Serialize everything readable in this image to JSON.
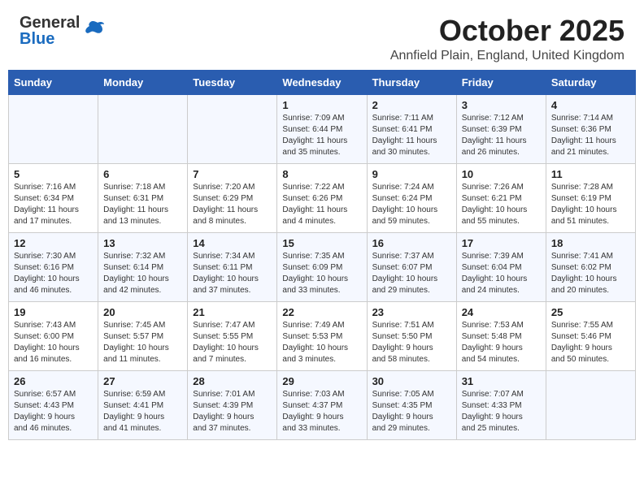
{
  "header": {
    "logo_line1": "General",
    "logo_line2": "Blue",
    "month": "October 2025",
    "location": "Annfield Plain, England, United Kingdom"
  },
  "weekdays": [
    "Sunday",
    "Monday",
    "Tuesday",
    "Wednesday",
    "Thursday",
    "Friday",
    "Saturday"
  ],
  "weeks": [
    [
      {
        "day": "",
        "detail": ""
      },
      {
        "day": "",
        "detail": ""
      },
      {
        "day": "",
        "detail": ""
      },
      {
        "day": "1",
        "detail": "Sunrise: 7:09 AM\nSunset: 6:44 PM\nDaylight: 11 hours\nand 35 minutes."
      },
      {
        "day": "2",
        "detail": "Sunrise: 7:11 AM\nSunset: 6:41 PM\nDaylight: 11 hours\nand 30 minutes."
      },
      {
        "day": "3",
        "detail": "Sunrise: 7:12 AM\nSunset: 6:39 PM\nDaylight: 11 hours\nand 26 minutes."
      },
      {
        "day": "4",
        "detail": "Sunrise: 7:14 AM\nSunset: 6:36 PM\nDaylight: 11 hours\nand 21 minutes."
      }
    ],
    [
      {
        "day": "5",
        "detail": "Sunrise: 7:16 AM\nSunset: 6:34 PM\nDaylight: 11 hours\nand 17 minutes."
      },
      {
        "day": "6",
        "detail": "Sunrise: 7:18 AM\nSunset: 6:31 PM\nDaylight: 11 hours\nand 13 minutes."
      },
      {
        "day": "7",
        "detail": "Sunrise: 7:20 AM\nSunset: 6:29 PM\nDaylight: 11 hours\nand 8 minutes."
      },
      {
        "day": "8",
        "detail": "Sunrise: 7:22 AM\nSunset: 6:26 PM\nDaylight: 11 hours\nand 4 minutes."
      },
      {
        "day": "9",
        "detail": "Sunrise: 7:24 AM\nSunset: 6:24 PM\nDaylight: 10 hours\nand 59 minutes."
      },
      {
        "day": "10",
        "detail": "Sunrise: 7:26 AM\nSunset: 6:21 PM\nDaylight: 10 hours\nand 55 minutes."
      },
      {
        "day": "11",
        "detail": "Sunrise: 7:28 AM\nSunset: 6:19 PM\nDaylight: 10 hours\nand 51 minutes."
      }
    ],
    [
      {
        "day": "12",
        "detail": "Sunrise: 7:30 AM\nSunset: 6:16 PM\nDaylight: 10 hours\nand 46 minutes."
      },
      {
        "day": "13",
        "detail": "Sunrise: 7:32 AM\nSunset: 6:14 PM\nDaylight: 10 hours\nand 42 minutes."
      },
      {
        "day": "14",
        "detail": "Sunrise: 7:34 AM\nSunset: 6:11 PM\nDaylight: 10 hours\nand 37 minutes."
      },
      {
        "day": "15",
        "detail": "Sunrise: 7:35 AM\nSunset: 6:09 PM\nDaylight: 10 hours\nand 33 minutes."
      },
      {
        "day": "16",
        "detail": "Sunrise: 7:37 AM\nSunset: 6:07 PM\nDaylight: 10 hours\nand 29 minutes."
      },
      {
        "day": "17",
        "detail": "Sunrise: 7:39 AM\nSunset: 6:04 PM\nDaylight: 10 hours\nand 24 minutes."
      },
      {
        "day": "18",
        "detail": "Sunrise: 7:41 AM\nSunset: 6:02 PM\nDaylight: 10 hours\nand 20 minutes."
      }
    ],
    [
      {
        "day": "19",
        "detail": "Sunrise: 7:43 AM\nSunset: 6:00 PM\nDaylight: 10 hours\nand 16 minutes."
      },
      {
        "day": "20",
        "detail": "Sunrise: 7:45 AM\nSunset: 5:57 PM\nDaylight: 10 hours\nand 11 minutes."
      },
      {
        "day": "21",
        "detail": "Sunrise: 7:47 AM\nSunset: 5:55 PM\nDaylight: 10 hours\nand 7 minutes."
      },
      {
        "day": "22",
        "detail": "Sunrise: 7:49 AM\nSunset: 5:53 PM\nDaylight: 10 hours\nand 3 minutes."
      },
      {
        "day": "23",
        "detail": "Sunrise: 7:51 AM\nSunset: 5:50 PM\nDaylight: 9 hours\nand 58 minutes."
      },
      {
        "day": "24",
        "detail": "Sunrise: 7:53 AM\nSunset: 5:48 PM\nDaylight: 9 hours\nand 54 minutes."
      },
      {
        "day": "25",
        "detail": "Sunrise: 7:55 AM\nSunset: 5:46 PM\nDaylight: 9 hours\nand 50 minutes."
      }
    ],
    [
      {
        "day": "26",
        "detail": "Sunrise: 6:57 AM\nSunset: 4:43 PM\nDaylight: 9 hours\nand 46 minutes."
      },
      {
        "day": "27",
        "detail": "Sunrise: 6:59 AM\nSunset: 4:41 PM\nDaylight: 9 hours\nand 41 minutes."
      },
      {
        "day": "28",
        "detail": "Sunrise: 7:01 AM\nSunset: 4:39 PM\nDaylight: 9 hours\nand 37 minutes."
      },
      {
        "day": "29",
        "detail": "Sunrise: 7:03 AM\nSunset: 4:37 PM\nDaylight: 9 hours\nand 33 minutes."
      },
      {
        "day": "30",
        "detail": "Sunrise: 7:05 AM\nSunset: 4:35 PM\nDaylight: 9 hours\nand 29 minutes."
      },
      {
        "day": "31",
        "detail": "Sunrise: 7:07 AM\nSunset: 4:33 PM\nDaylight: 9 hours\nand 25 minutes."
      },
      {
        "day": "",
        "detail": ""
      }
    ]
  ]
}
